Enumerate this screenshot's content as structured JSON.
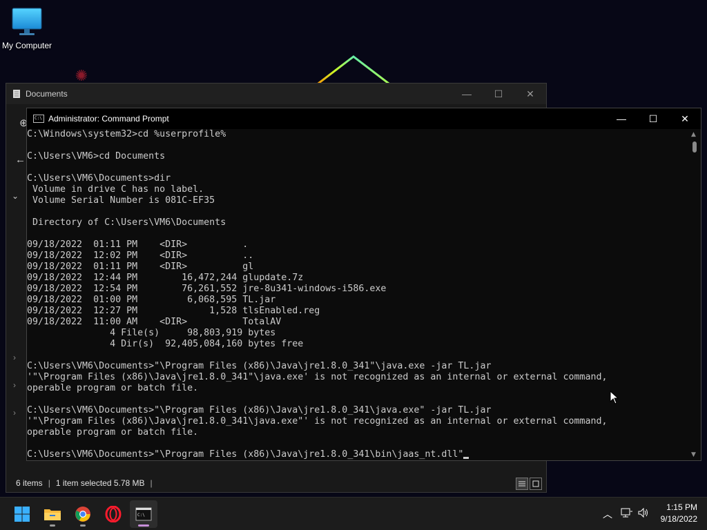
{
  "desktop": {
    "icons": [
      {
        "label": "My Computer",
        "icon": "monitor-icon"
      }
    ]
  },
  "explorer": {
    "title": "Documents",
    "status": {
      "item_count": "6 items",
      "selection": "1 item selected  5.78 MB"
    }
  },
  "cmd": {
    "title": "Administrator: Command Prompt",
    "lines": [
      "C:\\Windows\\system32>cd %userprofile%",
      "",
      "C:\\Users\\VM6>cd Documents",
      "",
      "C:\\Users\\VM6\\Documents>dir",
      " Volume in drive C has no label.",
      " Volume Serial Number is 081C-EF35",
      "",
      " Directory of C:\\Users\\VM6\\Documents",
      "",
      "09/18/2022  01:11 PM    <DIR>          .",
      "09/18/2022  12:02 PM    <DIR>          ..",
      "09/18/2022  01:11 PM    <DIR>          gl",
      "09/18/2022  12:44 PM        16,472,244 glupdate.7z",
      "09/18/2022  12:54 PM        76,261,552 jre-8u341-windows-i586.exe",
      "09/18/2022  01:00 PM         6,068,595 TL.jar",
      "09/18/2022  12:27 PM             1,528 tlsEnabled.reg",
      "09/18/2022  11:00 AM    <DIR>          TotalAV",
      "               4 File(s)     98,803,919 bytes",
      "               4 Dir(s)  92,405,084,160 bytes free",
      "",
      "C:\\Users\\VM6\\Documents>\"\\Program Files (x86)\\Java\\jre1.8.0_341\"\\java.exe -jar TL.jar",
      "'\"\\Program Files (x86)\\Java\\jre1.8.0_341\"\\java.exe' is not recognized as an internal or external command,",
      "operable program or batch file.",
      "",
      "C:\\Users\\VM6\\Documents>\"\\Program Files (x86)\\Java\\jre1.8.0_341\\java.exe\" -jar TL.jar",
      "'\"\\Program Files (x86)\\Java\\jre1.8.0_341\\java.exe\"' is not recognized as an internal or external command,",
      "operable program or batch file.",
      "",
      "C:\\Users\\VM6\\Documents>\"\\Program Files (x86)\\Java\\jre1.8.0_341\\bin\\jaas_nt.dll\""
    ]
  },
  "taskbar": {
    "apps": [
      {
        "name": "Start",
        "icon": "windows-start-icon"
      },
      {
        "name": "File Explorer",
        "icon": "folder-icon"
      },
      {
        "name": "Google Chrome",
        "icon": "chrome-icon"
      },
      {
        "name": "Opera",
        "icon": "opera-icon"
      },
      {
        "name": "Command Prompt",
        "icon": "terminal-icon"
      }
    ],
    "clock": {
      "time": "1:15 PM",
      "date": "9/18/2022"
    }
  },
  "colors": {
    "console_bg": "#0c0c0c",
    "console_text": "#cccccc",
    "taskbar_bg": "#1c1c1c",
    "active_indicator": "#c88fd9"
  }
}
